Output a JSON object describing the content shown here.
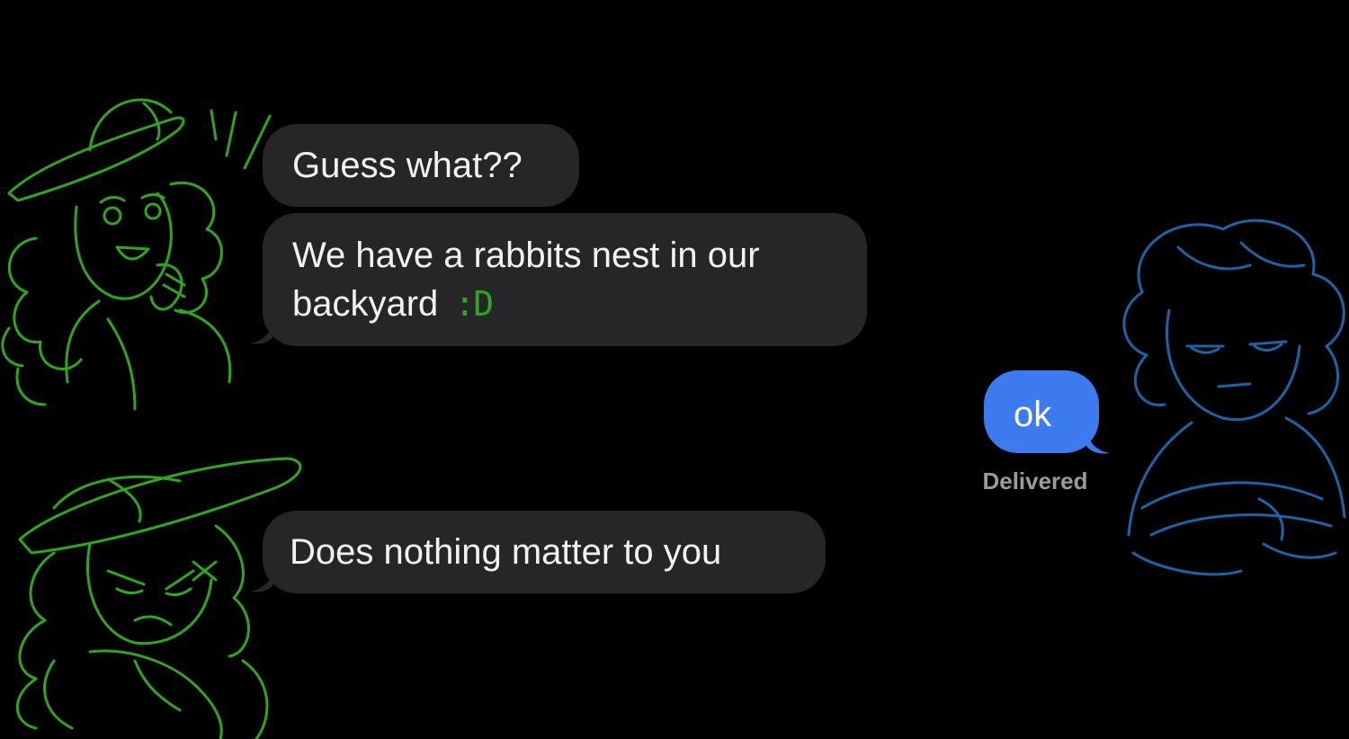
{
  "conversation": {
    "messages": [
      {
        "sender": "them",
        "text": "Guess what??"
      },
      {
        "sender": "them",
        "text": "We have a rabbits nest in our backyard",
        "emote": ":D"
      },
      {
        "sender": "me",
        "text": "ok"
      },
      {
        "sender": "them",
        "text": "Does nothing matter to you"
      }
    ],
    "delivery_status": "Delivered"
  },
  "colors": {
    "background": "#000000",
    "incoming_bubble": "#262628",
    "outgoing_bubble": "#3b7bef",
    "green_doodle": "#2ea81a",
    "blue_doodle": "#1a64a8"
  },
  "icons": {
    "top_left": "excited-character-doodle",
    "bottom_left": "upset-character-doodle",
    "right": "unimpressed-character-doodle"
  }
}
